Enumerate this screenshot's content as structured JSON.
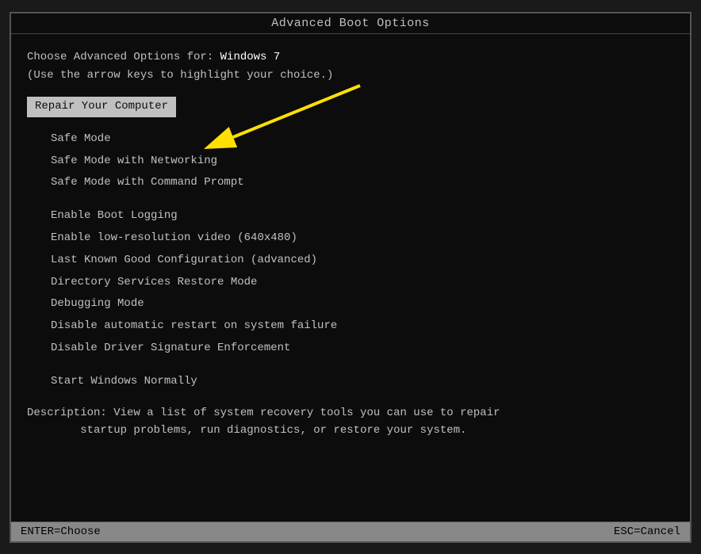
{
  "title_bar": {
    "label": "Advanced Boot Options"
  },
  "header": {
    "line1_prefix": "Choose Advanced Options for: ",
    "line1_os": "Windows 7",
    "line2": "(Use the arrow keys to highlight your choice.)"
  },
  "menu": {
    "selected_item": "Repair Your Computer",
    "groups": [
      {
        "items": [
          "Safe Mode",
          "Safe Mode with Networking",
          "Safe Mode with Command Prompt"
        ]
      },
      {
        "items": [
          "Enable Boot Logging",
          "Enable low-resolution video (640x480)",
          "Last Known Good Configuration (advanced)",
          "Directory Services Restore Mode",
          "Debugging Mode",
          "Disable automatic restart on system failure",
          "Disable Driver Signature Enforcement"
        ]
      },
      {
        "items": [
          "Start Windows Normally"
        ]
      }
    ]
  },
  "description": {
    "label": "Description:",
    "text": " View a list of system recovery tools you can use to repair\n        startup problems, run diagnostics, or restore your system."
  },
  "bottom_bar": {
    "left": "ENTER=Choose",
    "right": "ESC=Cancel"
  }
}
